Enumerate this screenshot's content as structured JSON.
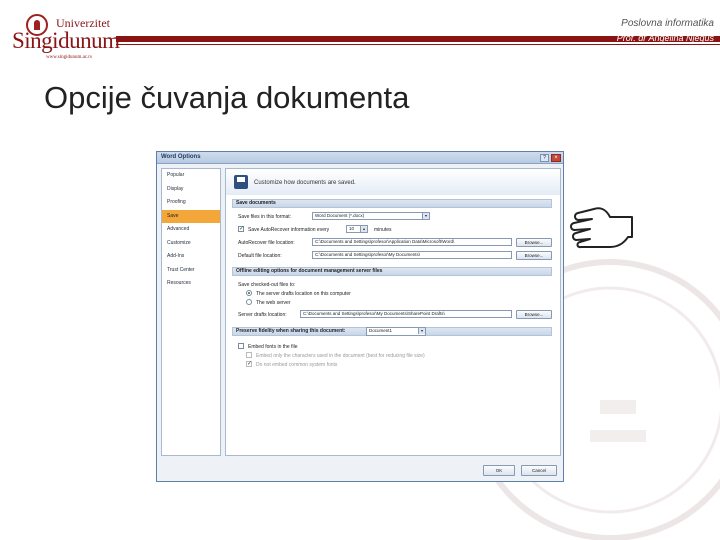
{
  "header": {
    "logo_top": "Univerzitet",
    "logo_name": "Singidunum",
    "logo_url": "www.singidunum.ac.rs",
    "course": "Poslovna informatika",
    "professor": "Prof. dr Angelina Njeguš"
  },
  "slide": {
    "title": "Opcije čuvanja dokumenta"
  },
  "colors": {
    "brand": "#8a1414",
    "selected_nav": "#f3a63a",
    "dialog_border": "#5f7fa8"
  },
  "dialog": {
    "title": "Word Options",
    "help": "?",
    "close": "×",
    "nav": [
      "Popular",
      "Display",
      "Proofing",
      "Save",
      "Advanced",
      "Customize",
      "Add-Ins",
      "Trust Center",
      "Resources"
    ],
    "selected_nav": "Save",
    "heading": "Customize how documents are saved.",
    "save_section": {
      "title": "Save documents",
      "format_label": "Save files in this format:",
      "format_value": "Word Document (*.docx)",
      "autorecover_label": "Save AutoRecover information every",
      "autorecover_value": "10",
      "minutes": "minutes",
      "autorecover_location_label": "AutoRecover file location:",
      "autorecover_location_value": "C:\\Documents and Settings\\profesor\\Application Data\\Microsoft\\Word\\",
      "default_location_label": "Default file location:",
      "default_location_value": "C:\\Documents and Settings\\profesor\\My Documents\\",
      "browse": "Browse..."
    },
    "offline_section": {
      "title": "Offline editing options for document management server files",
      "save_to_label": "Save checked-out files to:",
      "option_server": "The server drafts location on this computer",
      "option_web": "The web server",
      "drafts_label": "Server drafts location:",
      "drafts_value": "C:\\Documents and Settings\\profesor\\My Documents\\SharePoint Drafts\\",
      "browse": "Browse..."
    },
    "fidelity_section": {
      "title": "Preserve fidelity when sharing this document:",
      "doc_value": "Document1",
      "embed_fonts": "Embed fonts in the file",
      "embed_chars": "Embed only the characters used in the document (best for reducing file size)",
      "no_common": "Do not embed common system fonts"
    },
    "ok": "OK",
    "cancel": "Cancel"
  }
}
